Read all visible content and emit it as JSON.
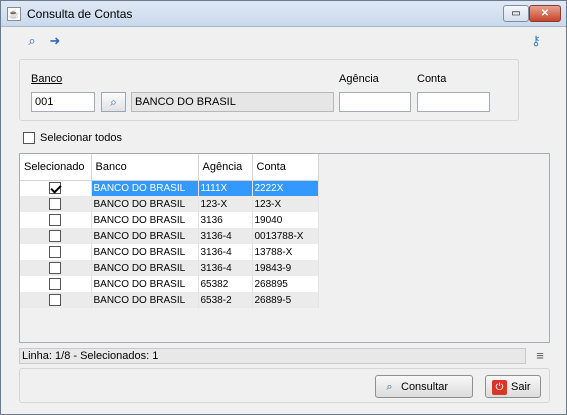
{
  "window": {
    "title": "Consulta de Contas",
    "icons": {
      "app": "java-cup-icon",
      "maximize": "maximize-icon",
      "close": "close-icon"
    }
  },
  "toolbar": {
    "icons": [
      "search-icon",
      "export-icon",
      "key-icon"
    ]
  },
  "filters": {
    "banco_label": "Banco",
    "banco_code": "001",
    "banco_name": "BANCO DO BRASIL",
    "agencia_label": "Agência",
    "agencia_value": "",
    "conta_label": "Conta",
    "conta_value": ""
  },
  "select_all_label": "Selecionar todos",
  "grid": {
    "columns": [
      "Selecionado",
      "Banco",
      "Agência",
      "Conta"
    ],
    "rows": [
      {
        "checked": true,
        "banco": "BANCO DO BRASIL",
        "agencia": "1111X",
        "conta": "2222X"
      },
      {
        "checked": false,
        "banco": "BANCO DO BRASIL",
        "agencia": "123-X",
        "conta": "123-X"
      },
      {
        "checked": false,
        "banco": "BANCO DO BRASIL",
        "agencia": "3136",
        "conta": "19040"
      },
      {
        "checked": false,
        "banco": "BANCO DO BRASIL",
        "agencia": "3136-4",
        "conta": "0013788-X"
      },
      {
        "checked": false,
        "banco": "BANCO DO BRASIL",
        "agencia": "3136-4",
        "conta": "13788-X"
      },
      {
        "checked": false,
        "banco": "BANCO DO BRASIL",
        "agencia": "3136-4",
        "conta": "19843-9"
      },
      {
        "checked": false,
        "banco": "BANCO DO BRASIL",
        "agencia": "65382",
        "conta": "268895"
      },
      {
        "checked": false,
        "banco": "BANCO DO BRASIL",
        "agencia": "6538-2",
        "conta": "26889-5"
      }
    ],
    "selected_row_index": 0
  },
  "status_text": "Linha: 1/8 - Selecionados: 1",
  "buttons": {
    "consultar": "Consultar",
    "sair": "Sair"
  },
  "colors": {
    "selection": "#3399ff",
    "alt_row": "#ebebeb",
    "exit_icon": "#d9362a"
  }
}
